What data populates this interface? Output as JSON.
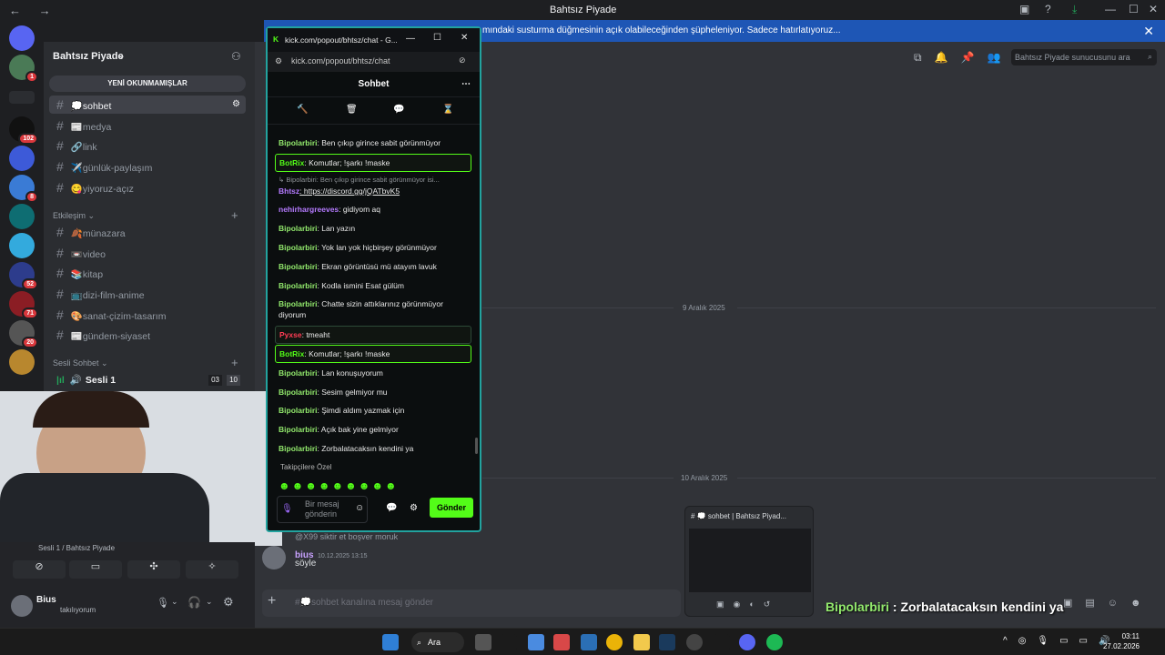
{
  "window": {
    "title": "Bahtsız Piyade",
    "nav": "← →"
  },
  "notice": {
    "text": "mındaki susturma düğmesinin açık olabileceğinden şüpheleniyor. Sadece hatırlatıyoruz..."
  },
  "server": {
    "name": "Bahtsız Piyade",
    "unread_button": "YENİ OKUNMAMIŞLAR",
    "channels": [
      {
        "label": "💭sohbet",
        "active": true
      },
      {
        "label": "📰medya"
      },
      {
        "label": "🔗link"
      },
      {
        "label": "✈️günlük-paylaşım"
      },
      {
        "label": "😋yiyoruz-açız"
      }
    ],
    "category_etkilesim": "Etkileşim",
    "channels2": [
      {
        "label": "🍂münazara"
      },
      {
        "label": "📼video"
      },
      {
        "label": "📚kitap"
      },
      {
        "label": "📺dizi-film-anime"
      },
      {
        "label": "🎨sanat-çizim-tasarım"
      },
      {
        "label": "📰gündem-siyaset"
      }
    ],
    "category_voice": "Sesli Sohbet",
    "voice_channel": "Sesli 1",
    "voice_counts": [
      "03",
      "10"
    ],
    "rail_badges": [
      "1",
      "102",
      "8",
      "52",
      "71",
      "20"
    ]
  },
  "main": {
    "search_placeholder": "Bahtsız Piyade sunucusunu ara",
    "date1": "9 Aralık 2025",
    "date2": "10 Aralık 2025",
    "reply_preview": "@X99 siktir et boşver moruk",
    "msg_author": "bius",
    "msg_time": "10.12.2025 13:15",
    "msg_text": "söyle",
    "composer_placeholder": "#💭sohbet kanalına mesaj gönder",
    "preview_title": "# 💭 sohbet | Bahtsız Piyad..."
  },
  "voice": {
    "status": "Sesli 1 / Bahtsız Piyade"
  },
  "user": {
    "name": "Bius",
    "status": "takılıyorum"
  },
  "popout": {
    "title": "kick.com/popout/bhtsz/chat - G...",
    "url": "kick.com/popout/bhtsz/chat",
    "header": "Sohbet",
    "messages": [
      {
        "user": "Bipolarbiri",
        "text": ": Ben çıkıp girince sabit görünmüyor"
      },
      {
        "user": "BotRix",
        "text": ": Komutlar; !şarkı !maske",
        "box": true
      },
      {
        "reply": "↳ Bipolarbiri: Ben çıkıp girince sabit görünmüyor isi..."
      },
      {
        "user": "Bhtsz",
        "text": ": https://discord.gg/jQATbvK5"
      },
      {
        "user": "nehirhargreeves",
        "text": ": gidiyom aq"
      },
      {
        "user": "Bipolarbiri",
        "text": ": Lan yazın"
      },
      {
        "user": "Bipolarbiri",
        "text": ": Yok lan yok hiçbirşey görünmüyor"
      },
      {
        "user": "Bipolarbiri",
        "text": ": Ekran görüntüsü mü atayım lavuk"
      },
      {
        "user": "Bipolarbiri",
        "text": ": Kodla ismini Esat gülüm"
      },
      {
        "user": "Bipolarbiri",
        "text": ": Chatte sizin attıklarınız görünmüyor diyorum"
      },
      {
        "user": "Pyxse",
        "text": ": tmeaht",
        "box": true
      },
      {
        "user": "BotRix",
        "text": ": Komutlar; !şarkı !maske",
        "box": true
      },
      {
        "user": "Bipolarbiri",
        "text": ": Lan konuşuyorum"
      },
      {
        "user": "Bipolarbiri",
        "text": ": Sesim gelmiyor mu"
      },
      {
        "user": "Bipolarbiri",
        "text": ": Şimdi aldım yazmak için"
      },
      {
        "user": "Bipolarbiri",
        "text": ": Açık bak yine gelmiyor"
      },
      {
        "user": "Bipolarbiri",
        "text": ": Zorbalatacaksın kendini ya"
      }
    ],
    "followers_label": "Takipçilere Özel",
    "input_placeholder": "Bir mesaj gönderin",
    "send_label": "Gönder"
  },
  "caption": {
    "name": "Bipolarbiri",
    "text": " : Zorbalatacaksın kendini ya"
  },
  "taskbar": {
    "search_label": "Ara",
    "time": "03:11",
    "date": "27.02.2026"
  }
}
